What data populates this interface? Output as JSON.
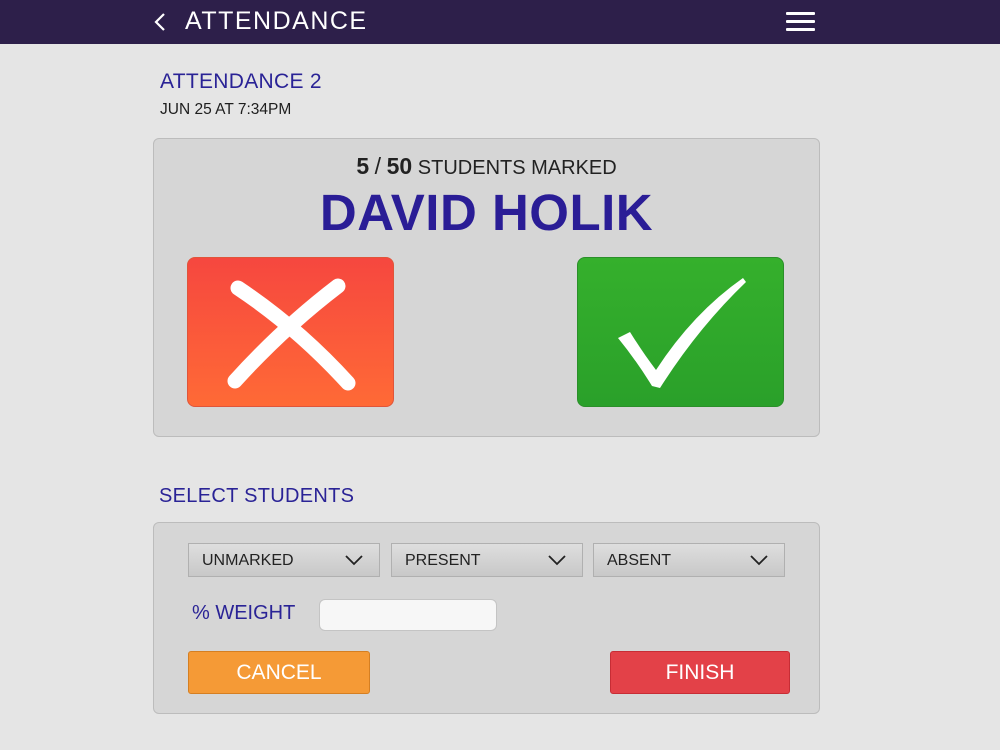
{
  "header": {
    "back_icon": "chevron-left-icon",
    "title": "ATTENDANCE",
    "menu_icon": "hamburger-menu-icon",
    "background_color": "#2d1f4a"
  },
  "session": {
    "title": "ATTENDANCE 2",
    "date": "JUN 25 AT 7:34PM"
  },
  "marking": {
    "marked_count": "5",
    "separator": "/",
    "total_count": "50",
    "progress_label": "STUDENTS MARKED",
    "student_name": "DAVID HOLIK",
    "absent_icon": "x-mark-icon",
    "present_icon": "checkmark-icon",
    "absent_color": "#f6473f",
    "present_color": "#35b02c"
  },
  "select_students": {
    "title": "SELECT STUDENTS",
    "filters": [
      "UNMARKED",
      "PRESENT",
      "ABSENT"
    ],
    "weight_label": "% WEIGHT",
    "weight_value": "",
    "cancel_label": "CANCEL",
    "finish_label": "FINISH",
    "cancel_color": "#f59a36",
    "finish_color": "#e34148"
  }
}
